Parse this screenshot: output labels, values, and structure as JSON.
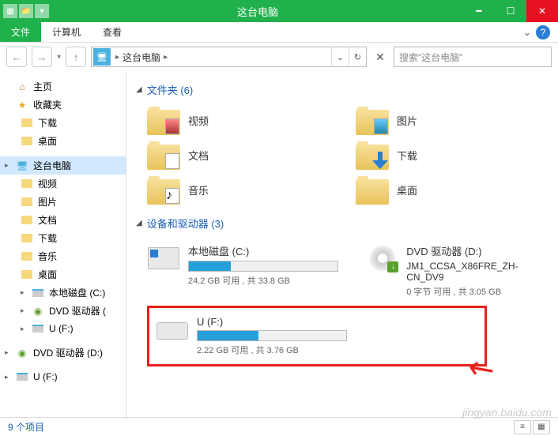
{
  "titlebar": {
    "title": "这台电脑"
  },
  "ribbon": {
    "file": "文件",
    "tabs": [
      "计算机",
      "查看"
    ]
  },
  "nav": {
    "breadcrumb": "这台电脑",
    "search_placeholder": "搜索\"这台电脑\""
  },
  "sidebar": {
    "home": "主页",
    "favorites": "收藏夹",
    "fav_items": [
      "下载",
      "桌面"
    ],
    "this_pc": "这台电脑",
    "pc_items": [
      "视频",
      "图片",
      "文档",
      "下载",
      "音乐",
      "桌面",
      "本地磁盘 (C:)",
      "DVD 驱动器 (",
      "U (F:)"
    ],
    "dvd_drive": "DVD 驱动器 (D:)",
    "u_drive": "U (F:)"
  },
  "content": {
    "folders_header": "文件夹 (6)",
    "folders": [
      "视频",
      "图片",
      "文档",
      "下载",
      "音乐",
      "桌面"
    ],
    "drives_header": "设备和驱动器 (3)",
    "drive_c": {
      "name": "本地磁盘 (C:)",
      "stats": "24.2 GB 可用 , 共 33.8 GB",
      "fill_pct": 28
    },
    "drive_dvd": {
      "name": "DVD 驱动器 (D:)",
      "sub": "JM1_CCSA_X86FRE_ZH-CN_DV9",
      "stats": "0 字节 可用 , 共 3.05 GB"
    },
    "drive_u": {
      "name": "U (F:)",
      "stats": "2.22 GB 可用 , 共 3.76 GB",
      "fill_pct": 41
    }
  },
  "statusbar": {
    "text": "9 个项目"
  },
  "watermark": "jingyan.baidu.com"
}
